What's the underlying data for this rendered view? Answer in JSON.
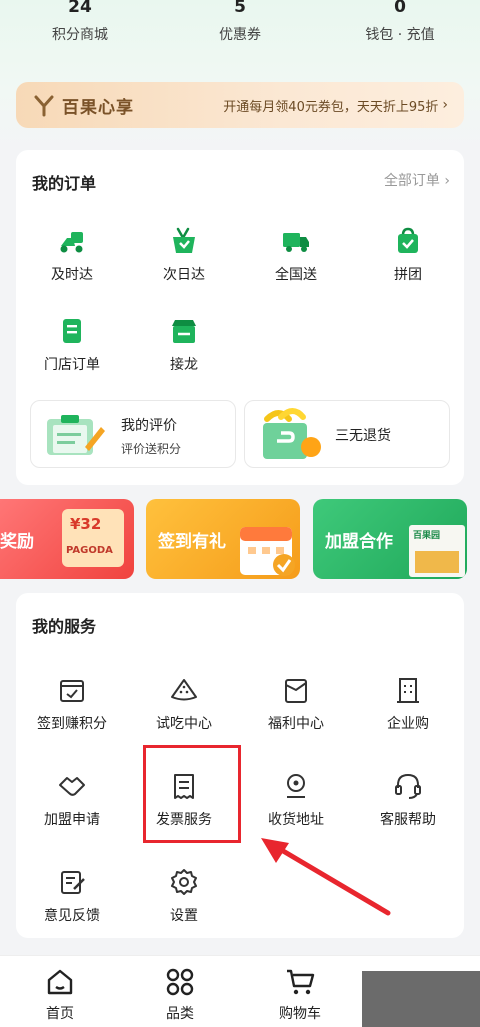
{
  "stats": [
    {
      "value": "24",
      "label": "积分商城"
    },
    {
      "value": "5",
      "label": "优惠券"
    },
    {
      "value": "0",
      "label": "钱包 · 充值"
    }
  ],
  "vip": {
    "brand": "百果心享",
    "promo": "开通每月领40元券包，天天折上95折",
    "arrow": "›"
  },
  "orders": {
    "title": "我的订单",
    "all_label": "全部订单",
    "all_arrow": "›",
    "row1": [
      {
        "label": "及时达",
        "icon": "scooter-icon"
      },
      {
        "label": "次日达",
        "icon": "basket-icon"
      },
      {
        "label": "全国送",
        "icon": "truck-icon"
      },
      {
        "label": "拼团",
        "icon": "bag-icon"
      }
    ],
    "row2": [
      {
        "label": "门店订单",
        "icon": "receipt-icon"
      },
      {
        "label": "接龙",
        "icon": "store-icon"
      }
    ],
    "review": {
      "title": "我的评价",
      "subtitle": "评价送积分"
    },
    "refund": {
      "title": "三无退货"
    }
  },
  "banners": [
    {
      "title": "奖励",
      "coupon": "¥32",
      "brand": "PAGODA"
    },
    {
      "title": "签到有礼"
    },
    {
      "title": "加盟合作",
      "store": "百果园"
    }
  ],
  "services": {
    "title": "我的服务",
    "row1": [
      {
        "label": "签到赚积分",
        "icon": "calendar-check-icon"
      },
      {
        "label": "试吃中心",
        "icon": "watermelon-icon"
      },
      {
        "label": "福利中心",
        "icon": "gift-card-icon"
      },
      {
        "label": "企业购",
        "icon": "building-icon"
      }
    ],
    "row2": [
      {
        "label": "加盟申请",
        "icon": "handshake-icon"
      },
      {
        "label": "发票服务",
        "icon": "invoice-icon"
      },
      {
        "label": "收货地址",
        "icon": "location-pin-icon"
      },
      {
        "label": "客服帮助",
        "icon": "headset-icon"
      }
    ],
    "row3": [
      {
        "label": "意见反馈",
        "icon": "feedback-edit-icon"
      },
      {
        "label": "设置",
        "icon": "gear-icon"
      }
    ]
  },
  "tabs": [
    {
      "label": "首页",
      "icon": "home-icon"
    },
    {
      "label": "品类",
      "icon": "category-icon"
    },
    {
      "label": "购物车",
      "icon": "cart-icon"
    }
  ],
  "colors": {
    "brand_green": "#1fb45c",
    "annotation_red": "#e8262e",
    "vip_gold": "#f7d9b7"
  }
}
